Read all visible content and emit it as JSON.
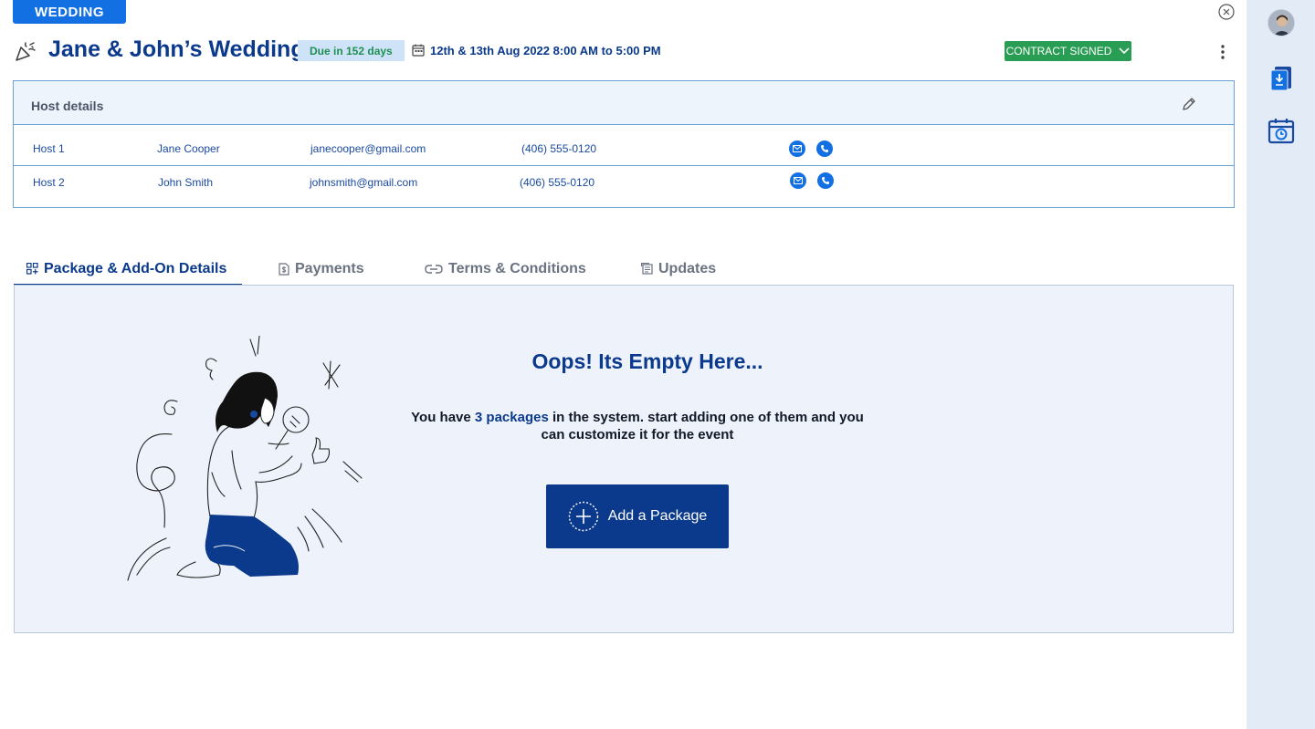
{
  "event_tag": "WEDDING",
  "header": {
    "title": "Jane & John’s Wedding",
    "due_label": "Due in 152 days",
    "date_time": "12th & 13th Aug 2022  8:00 AM to 5:00 PM",
    "contract_status": "CONTRACT SIGNED"
  },
  "host_details": {
    "title": "Host details",
    "hosts": [
      {
        "label": "Host 1",
        "name": "Jane Cooper",
        "email": "janecooper@gmail.com",
        "phone": "(406) 555-0120"
      },
      {
        "label": "Host 2",
        "name": "John Smith",
        "email": "johnsmith@gmail.com",
        "phone": "(406) 555-0120"
      }
    ]
  },
  "tabs": [
    {
      "label": "Package & Add-On Details",
      "icon": "package-icon",
      "active": true
    },
    {
      "label": "Payments",
      "icon": "payments-icon",
      "active": false
    },
    {
      "label": "Terms & Conditions",
      "icon": "link-icon",
      "active": false
    },
    {
      "label": "Updates",
      "icon": "updates-icon",
      "active": false
    }
  ],
  "empty_state": {
    "heading": "Oops! Its Empty Here...",
    "message_before": "You have ",
    "message_highlight": "3 packages",
    "message_after": " in the system. start adding one of them and you can customize it for the event",
    "button_label": "Add a Package"
  },
  "colors": {
    "primary": "#0b3a8c",
    "accent": "#1270e3",
    "success": "#2a9d55",
    "panel_bg": "#eef3fb"
  }
}
